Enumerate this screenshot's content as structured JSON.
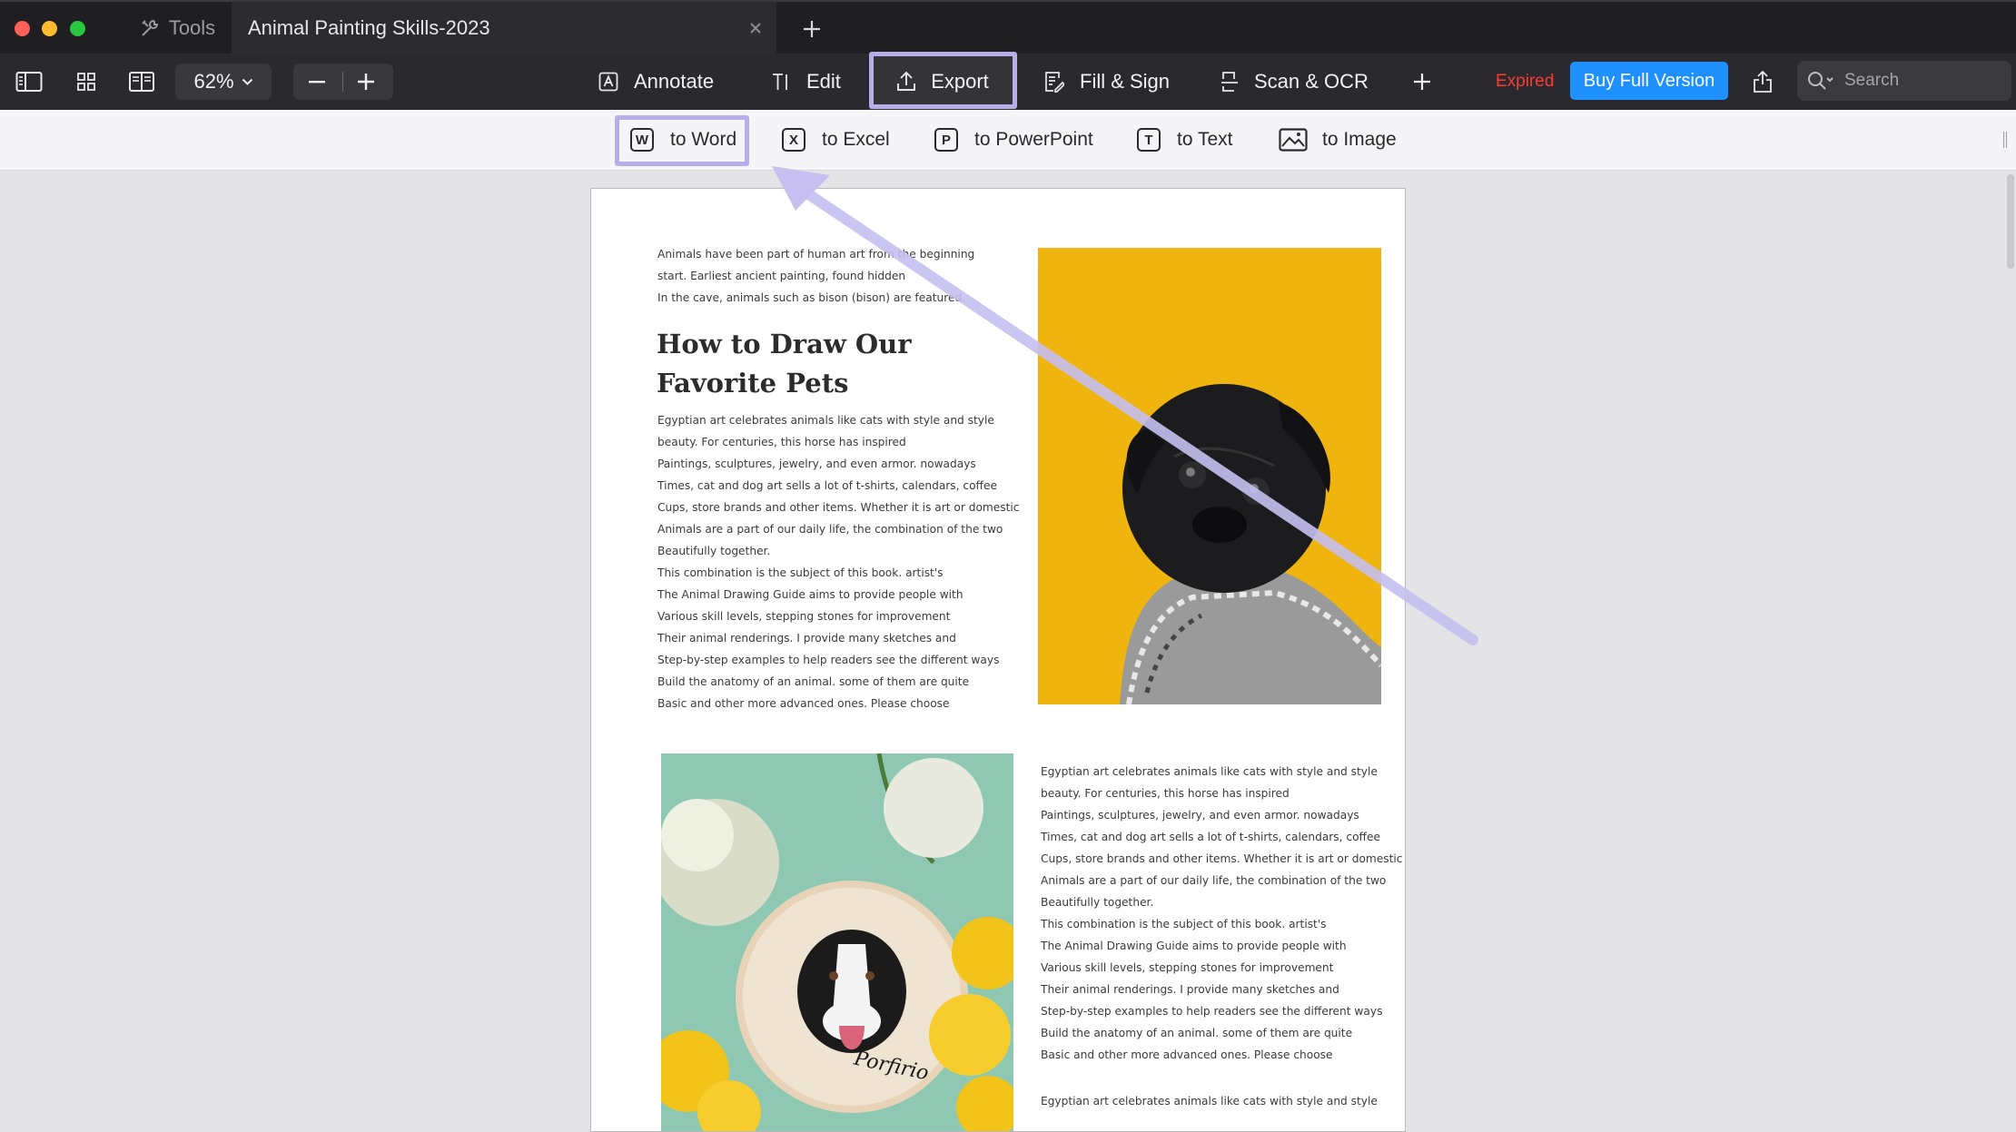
{
  "window": {
    "tabs": [
      {
        "label": "Tools",
        "icon": "tools-icon"
      },
      {
        "label": "Animal Painting Skills-2023",
        "icon": "close-icon"
      }
    ],
    "new_tab_icon": "plus-icon",
    "traffic_lights": {
      "close": "#fe5f57",
      "minimize": "#febc2e",
      "zoom": "#28c840"
    }
  },
  "toolbar": {
    "zoom": "62%",
    "annotate": "Annotate",
    "edit": "Edit",
    "export": "Export",
    "fill_sign": "Fill & Sign",
    "scan_ocr": "Scan & OCR",
    "expired": "Expired",
    "buy": "Buy Full Version",
    "search_placeholder": "Search",
    "colors": {
      "expired": "#ff3b30",
      "buy_bg": "#1e90ff"
    }
  },
  "export_bar": {
    "items": [
      {
        "label": "to Word",
        "badge": "W"
      },
      {
        "label": "to Excel",
        "badge": "X"
      },
      {
        "label": "to PowerPoint",
        "badge": "P"
      },
      {
        "label": "to Text",
        "badge": "T"
      },
      {
        "label": "to Image",
        "badge": ""
      }
    ]
  },
  "document": {
    "intro_lines": [
      "Animals have been part of human art from the beginning",
      "start. Earliest ancient painting, found hidden",
      "In the cave, animals such as bison (bison) are featured."
    ],
    "heading_lines": [
      "How to Draw Our",
      "Favorite Pets"
    ],
    "body_lines": [
      "Egyptian art celebrates animals like cats with style and style",
      "beauty. For centuries, this horse has inspired",
      "Paintings, sculptures, jewelry, and even armor. nowadays",
      "Times, cat and dog art sells a lot of t-shirts, calendars, coffee",
      "Cups, store brands and other items. Whether it is art or domestic",
      "Animals are a part of our daily life, the combination of the two",
      "Beautifully together.",
      "This combination is the subject of this book. artist's",
      "The Animal Drawing Guide aims to provide people with",
      "Various skill levels, stepping stones for improvement",
      "Their animal renderings. I provide many sketches and",
      "Step-by-step examples to help readers see the different ways",
      "Build the anatomy of an animal. some of them are quite",
      "Basic and other more advanced ones. Please choose"
    ],
    "last_line": "Egyptian art celebrates animals like cats with style and style",
    "embroidery_caption": "Porfirio",
    "image_colors": {
      "pug_bg": "#f0b40e",
      "embroidery_bg": "#8fc8b2"
    }
  }
}
